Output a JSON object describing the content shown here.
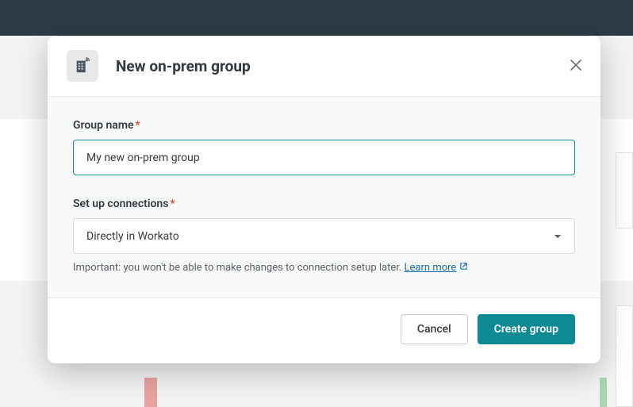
{
  "modal": {
    "title": "New on-prem group",
    "icon": "onprem-building-icon",
    "close_label": "Close",
    "form": {
      "group_name": {
        "label": "Group name",
        "required": true,
        "value": "My new on-prem group"
      },
      "setup_connections": {
        "label": "Set up connections",
        "required": true,
        "selected": "Directly in Workato",
        "helper_prefix": "Important: you won't be able to make changes to connection setup later. ",
        "learn_more_label": "Learn more"
      }
    },
    "footer": {
      "cancel_label": "Cancel",
      "create_label": "Create group"
    }
  }
}
